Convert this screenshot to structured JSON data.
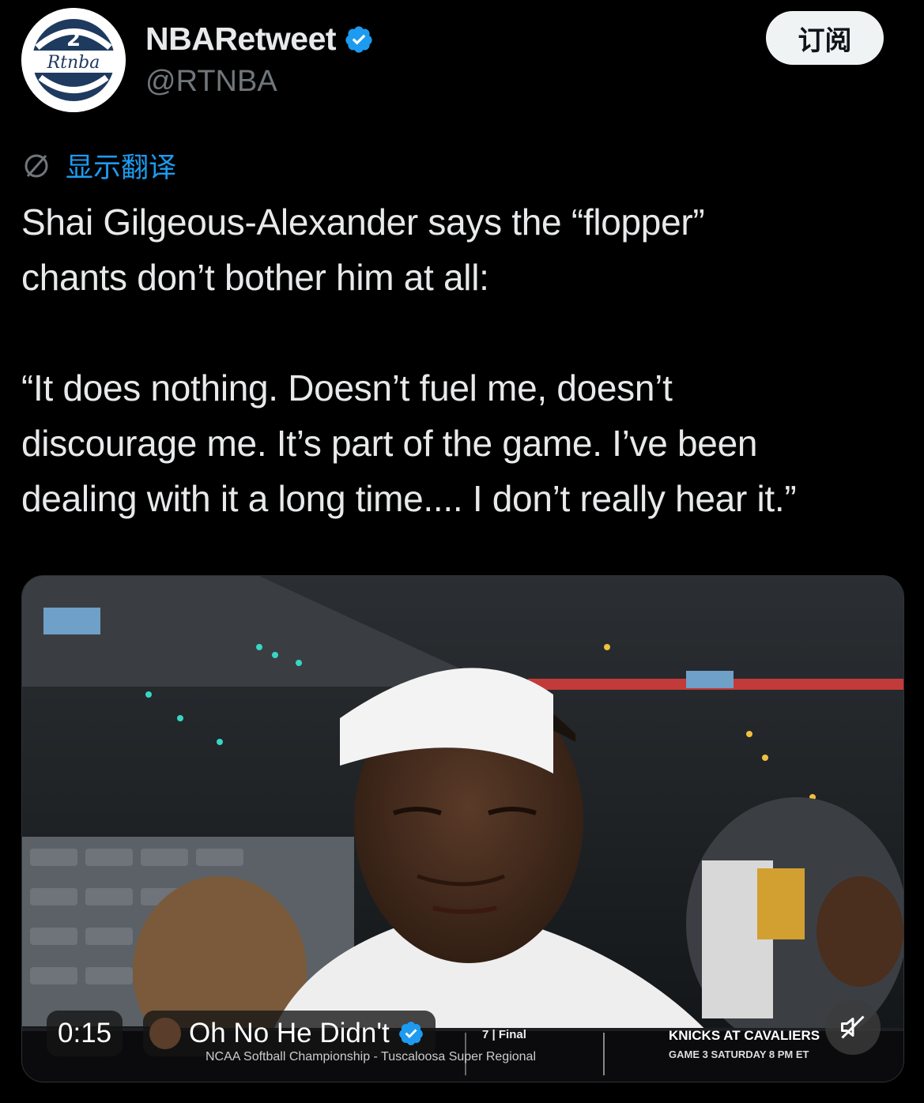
{
  "author": {
    "display_name": "NBARetweet",
    "handle": "@RTNBA",
    "avatar_text": "Rtnba"
  },
  "subscribe_label": "订阅",
  "translate_label": "显示翻译",
  "tweet_text": "Shai Gilgeous-Alexander says the “flopper”\nchants don’t bother him at all:\n\n“It does nothing. Doesn’t fuel me, doesn’t\ndiscourage me. It’s part of the game. I’ve been\ndealing with it a long time.... I don’t really hear it.”",
  "video": {
    "timestamp": "0:15",
    "source_name": "Oh No He Didn't",
    "ticker_final": "7 | Final",
    "ticker_line": "NCAA Softball Championship - Tuscaloosa Super Regional",
    "ticker_matchup": "KNICKS AT CAVALIERS",
    "ticker_game": "GAME 3 SATURDAY 8 PM ET"
  },
  "colors": {
    "accent": "#1d9bf0",
    "background": "#000000",
    "text": "#e7e9ea",
    "muted": "#71767b"
  }
}
